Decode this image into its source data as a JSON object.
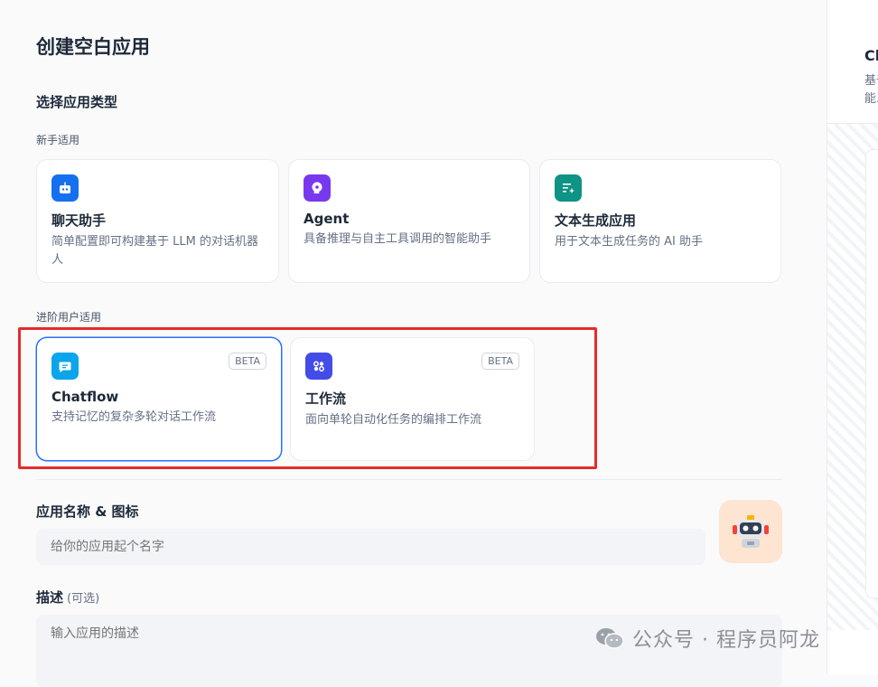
{
  "page_title": "创建空白应用",
  "choose_type_label": "选择应用类型",
  "beginner_group_label": "新手适用",
  "advanced_group_label": "进阶用户适用",
  "beginner_cards": [
    {
      "title": "聊天助手",
      "desc": "简单配置即可构建基于 LLM 的对话机器人",
      "icon": "chat-bot-icon",
      "color": "#1570ef"
    },
    {
      "title": "Agent",
      "desc": "具备推理与自主工具调用的智能助手",
      "icon": "agent-icon",
      "color": "#7839ee"
    },
    {
      "title": "文本生成应用",
      "desc": "用于文本生成任务的 AI 助手",
      "icon": "text-generation-icon",
      "color": "#0e9384"
    }
  ],
  "advanced_cards": [
    {
      "title": "Chatflow",
      "desc": "支持记忆的复杂多轮对话工作流",
      "badge": "BETA",
      "icon": "chatflow-icon",
      "color": "#0ba5ec",
      "selected": true
    },
    {
      "title": "工作流",
      "desc": "面向单轮自动化任务的编排工作流",
      "badge": "BETA",
      "icon": "workflow-icon",
      "color": "#444ce7",
      "selected": false
    }
  ],
  "name_label": "应用名称 & 图标",
  "name_placeholder": "给你的应用起个名字",
  "desc_label": "描述",
  "desc_optional": "(可选)",
  "desc_placeholder": "输入应用的描述",
  "watermark_text": "公众号 · 程序员阿龙",
  "right_panel": {
    "title": "Chatflow",
    "line1": "基于...",
    "line2": "能..."
  },
  "colors": {
    "highlight_box": "#e52b2b",
    "selected_border": "#2970ff"
  }
}
